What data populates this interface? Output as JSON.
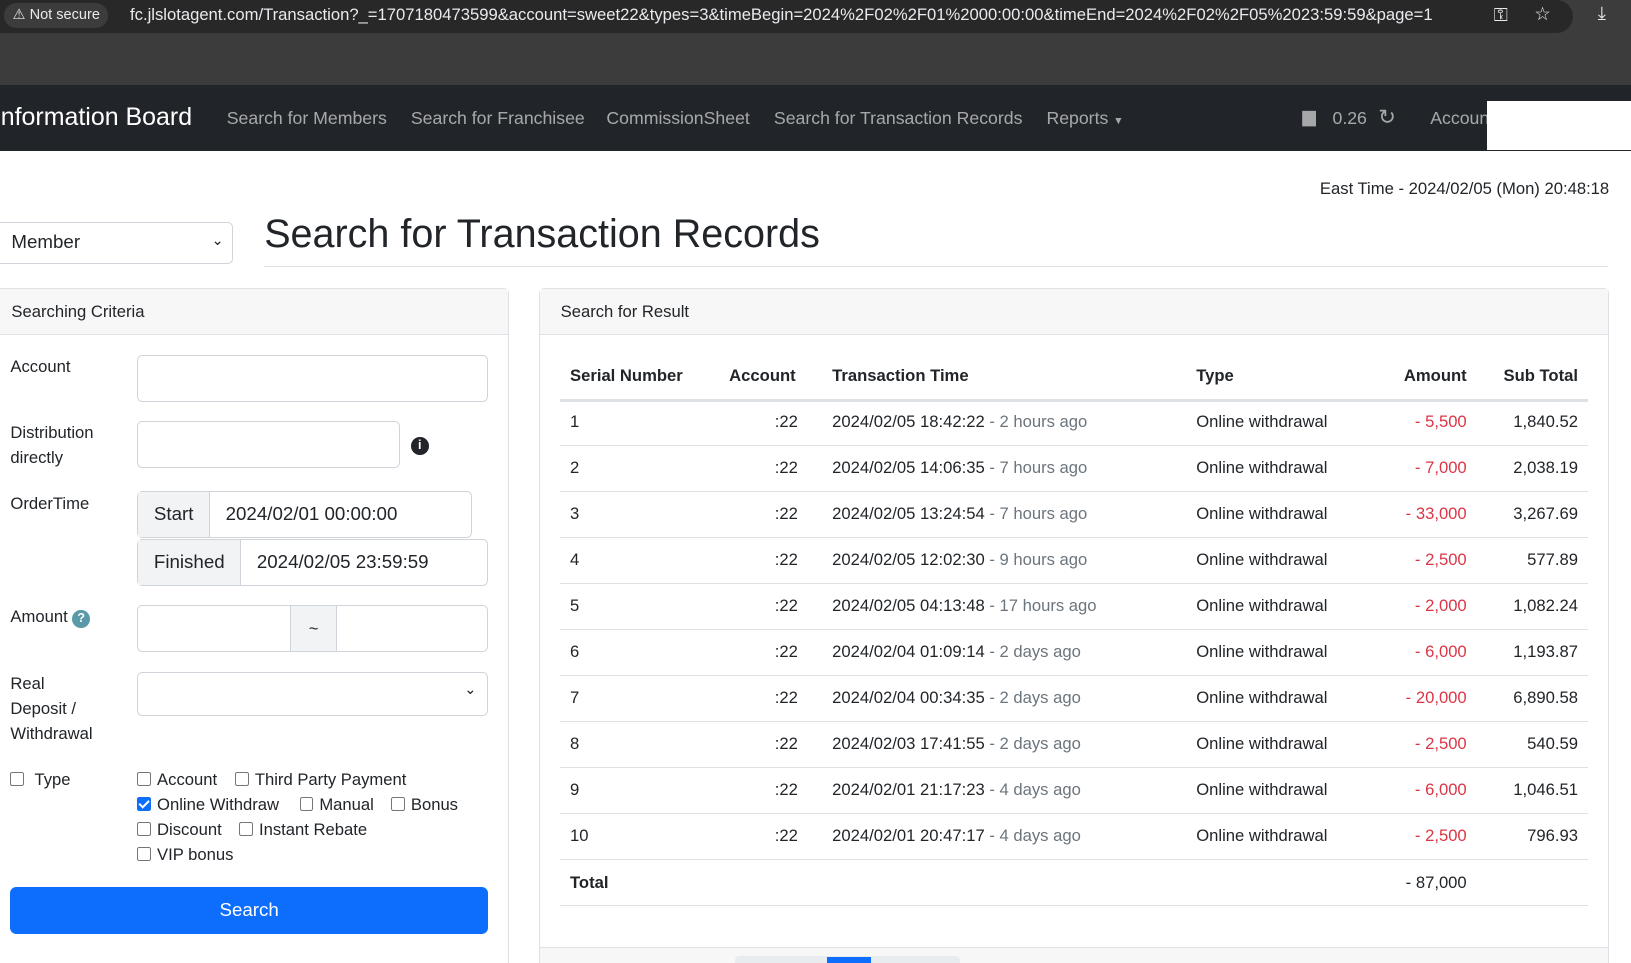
{
  "browser": {
    "security_label": "Not secure",
    "url": "fc.jlslotagent.com/Transaction?_=1707180473599&account=sweet22&types=3&timeBegin=2024%2F02%2F01%2000:00:00&timeEnd=2024%2F02%2F05%2023:59:59&page=1"
  },
  "nav": {
    "brand": "Information Board",
    "links": [
      "Search for Members",
      "Search for Franchisee",
      "CommissionSheet",
      "Search for Transaction Records",
      "Reports"
    ],
    "balance": "0.26",
    "account": "Accoun"
  },
  "east_time": "East Time - 2024/02/05 (Mon) 20:48:18",
  "member_select": "Member",
  "page_title": "Search for Transaction Records",
  "criteria": {
    "title": "Searching Criteria",
    "account_label": "Account",
    "account_value": "",
    "distribution_label_1": "Distribution",
    "distribution_label_2": "directly",
    "ordertime_label": "OrderTime",
    "start_label": "Start",
    "start_value": "2024/02/01 00:00:00",
    "finished_label": "Finished",
    "finished_value": "2024/02/05 23:59:59",
    "amount_label": "Amount",
    "amount_sep": "~",
    "real_label_1": "Real",
    "real_label_2": "Deposit /",
    "real_label_3": "Withdrawal",
    "type_label": "Type",
    "types": [
      {
        "label": "Account",
        "checked": false
      },
      {
        "label": "Third Party Payment",
        "checked": false
      },
      {
        "label": "Online Withdraw",
        "checked": true
      },
      {
        "label": "Manual",
        "checked": false
      },
      {
        "label": "Bonus",
        "checked": false
      },
      {
        "label": "Discount",
        "checked": false
      },
      {
        "label": "Instant Rebate",
        "checked": false
      },
      {
        "label": "VIP bonus",
        "checked": false
      }
    ],
    "search_button": "Search"
  },
  "result": {
    "title": "Search for Result",
    "columns": [
      "Serial Number",
      "Account",
      "Transaction Time",
      "Type",
      "Amount",
      "Sub Total"
    ],
    "rows": [
      {
        "serial": "1",
        "account": ":22",
        "time": "2024/02/05 18:42:22",
        "ago": "- 2 hours ago",
        "type": "Online withdrawal",
        "amount": "- 5,500",
        "subtotal": "1,840.52"
      },
      {
        "serial": "2",
        "account": ":22",
        "time": "2024/02/05 14:06:35",
        "ago": "- 7 hours ago",
        "type": "Online withdrawal",
        "amount": "- 7,000",
        "subtotal": "2,038.19"
      },
      {
        "serial": "3",
        "account": ":22",
        "time": "2024/02/05 13:24:54",
        "ago": "- 7 hours ago",
        "type": "Online withdrawal",
        "amount": "- 33,000",
        "subtotal": "3,267.69"
      },
      {
        "serial": "4",
        "account": ":22",
        "time": "2024/02/05 12:02:30",
        "ago": "- 9 hours ago",
        "type": "Online withdrawal",
        "amount": "- 2,500",
        "subtotal": "577.89"
      },
      {
        "serial": "5",
        "account": ":22",
        "time": "2024/02/05 04:13:48",
        "ago": "- 17 hours ago",
        "type": "Online withdrawal",
        "amount": "- 2,000",
        "subtotal": "1,082.24"
      },
      {
        "serial": "6",
        "account": ":22",
        "time": "2024/02/04 01:09:14",
        "ago": "- 2 days ago",
        "type": "Online withdrawal",
        "amount": "- 6,000",
        "subtotal": "1,193.87"
      },
      {
        "serial": "7",
        "account": ":22",
        "time": "2024/02/04 00:34:35",
        "ago": "- 2 days ago",
        "type": "Online withdrawal",
        "amount": "- 20,000",
        "subtotal": "6,890.58"
      },
      {
        "serial": "8",
        "account": ":22",
        "time": "2024/02/03 17:41:55",
        "ago": "- 2 days ago",
        "type": "Online withdrawal",
        "amount": "- 2,500",
        "subtotal": "540.59"
      },
      {
        "serial": "9",
        "account": ":22",
        "time": "2024/02/01 21:17:23",
        "ago": "- 4 days ago",
        "type": "Online withdrawal",
        "amount": "- 6,000",
        "subtotal": "1,046.51"
      },
      {
        "serial": "10",
        "account": ":22",
        "time": "2024/02/01 20:47:17",
        "ago": "- 4 days ago",
        "type": "Online withdrawal",
        "amount": "- 2,500",
        "subtotal": "796.93"
      }
    ],
    "total_label": "Total",
    "total_amount": "- 87,000"
  },
  "colors": {
    "primary": "#0d6efd",
    "negative": "#dc3545",
    "navbar": "#212529"
  }
}
